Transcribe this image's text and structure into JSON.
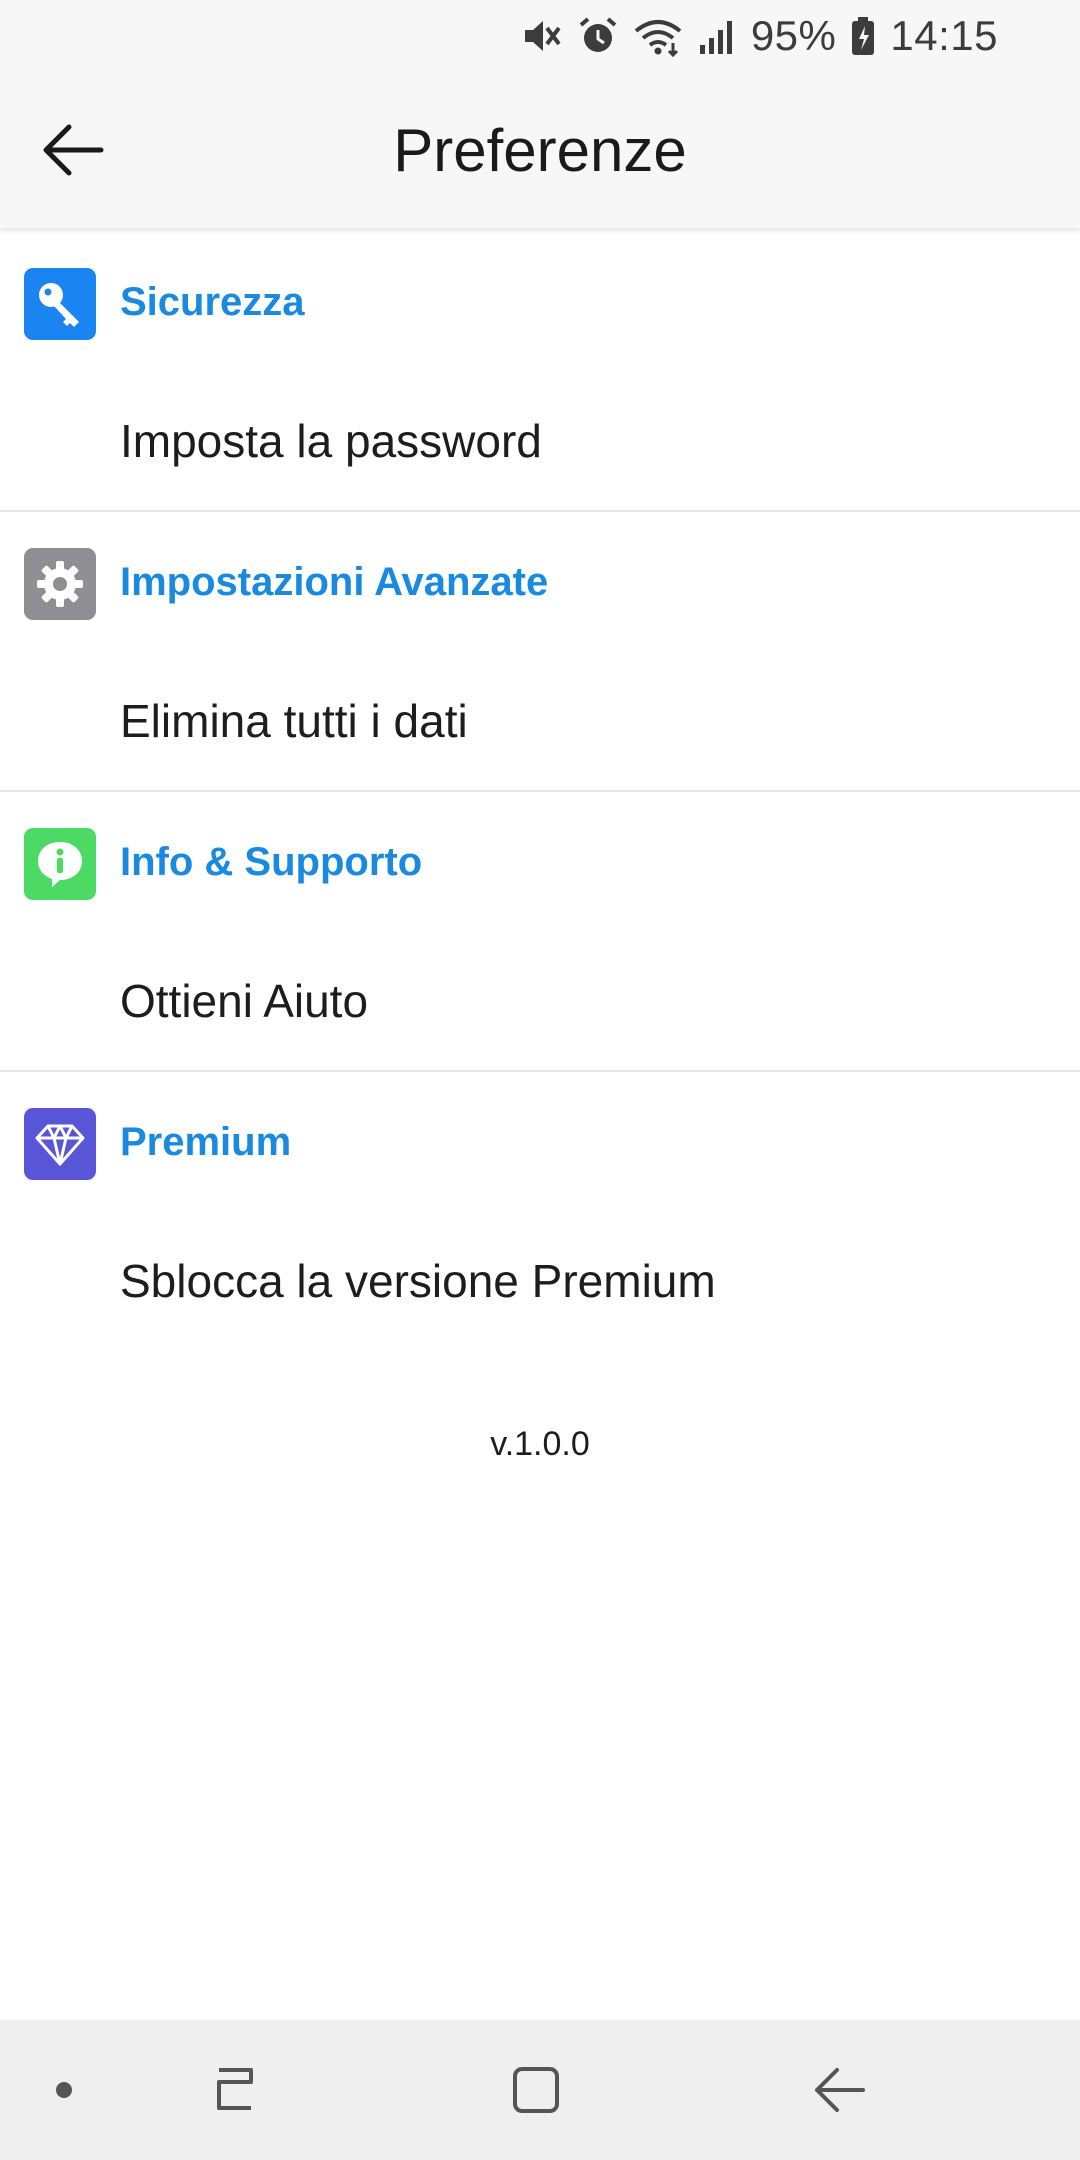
{
  "status_bar": {
    "battery": "95%",
    "time": "14:15",
    "icons": [
      "mute-icon",
      "alarm-icon",
      "wifi-icon",
      "signal-icon",
      "battery-charging-icon"
    ]
  },
  "app_bar": {
    "title": "Preferenze",
    "back_icon": "arrow-left-icon"
  },
  "sections": [
    {
      "title": "Sicurezza",
      "icon": "key-icon",
      "icon_color": "#1a84f0",
      "item": "Imposta la password"
    },
    {
      "title": "Impostazioni Avanzate",
      "icon": "gear-icon",
      "icon_color": "#8e8e93",
      "item": "Elimina tutti i dati"
    },
    {
      "title": "Info & Supporto",
      "icon": "info-bubble-icon",
      "icon_color": "#4cd964",
      "item": "Ottieni Aiuto"
    },
    {
      "title": "Premium",
      "icon": "diamond-icon",
      "icon_color": "#5856d6",
      "item": "Sblocca la versione Premium"
    }
  ],
  "version": "v.1.0.0",
  "colors": {
    "accent": "#1a8ae0",
    "bar_background": "#f7f7f7",
    "nav_background": "#efefef"
  },
  "nav_bar": {
    "icons": [
      "nav-dot-icon",
      "recent-apps-icon",
      "home-icon",
      "back-icon"
    ]
  }
}
